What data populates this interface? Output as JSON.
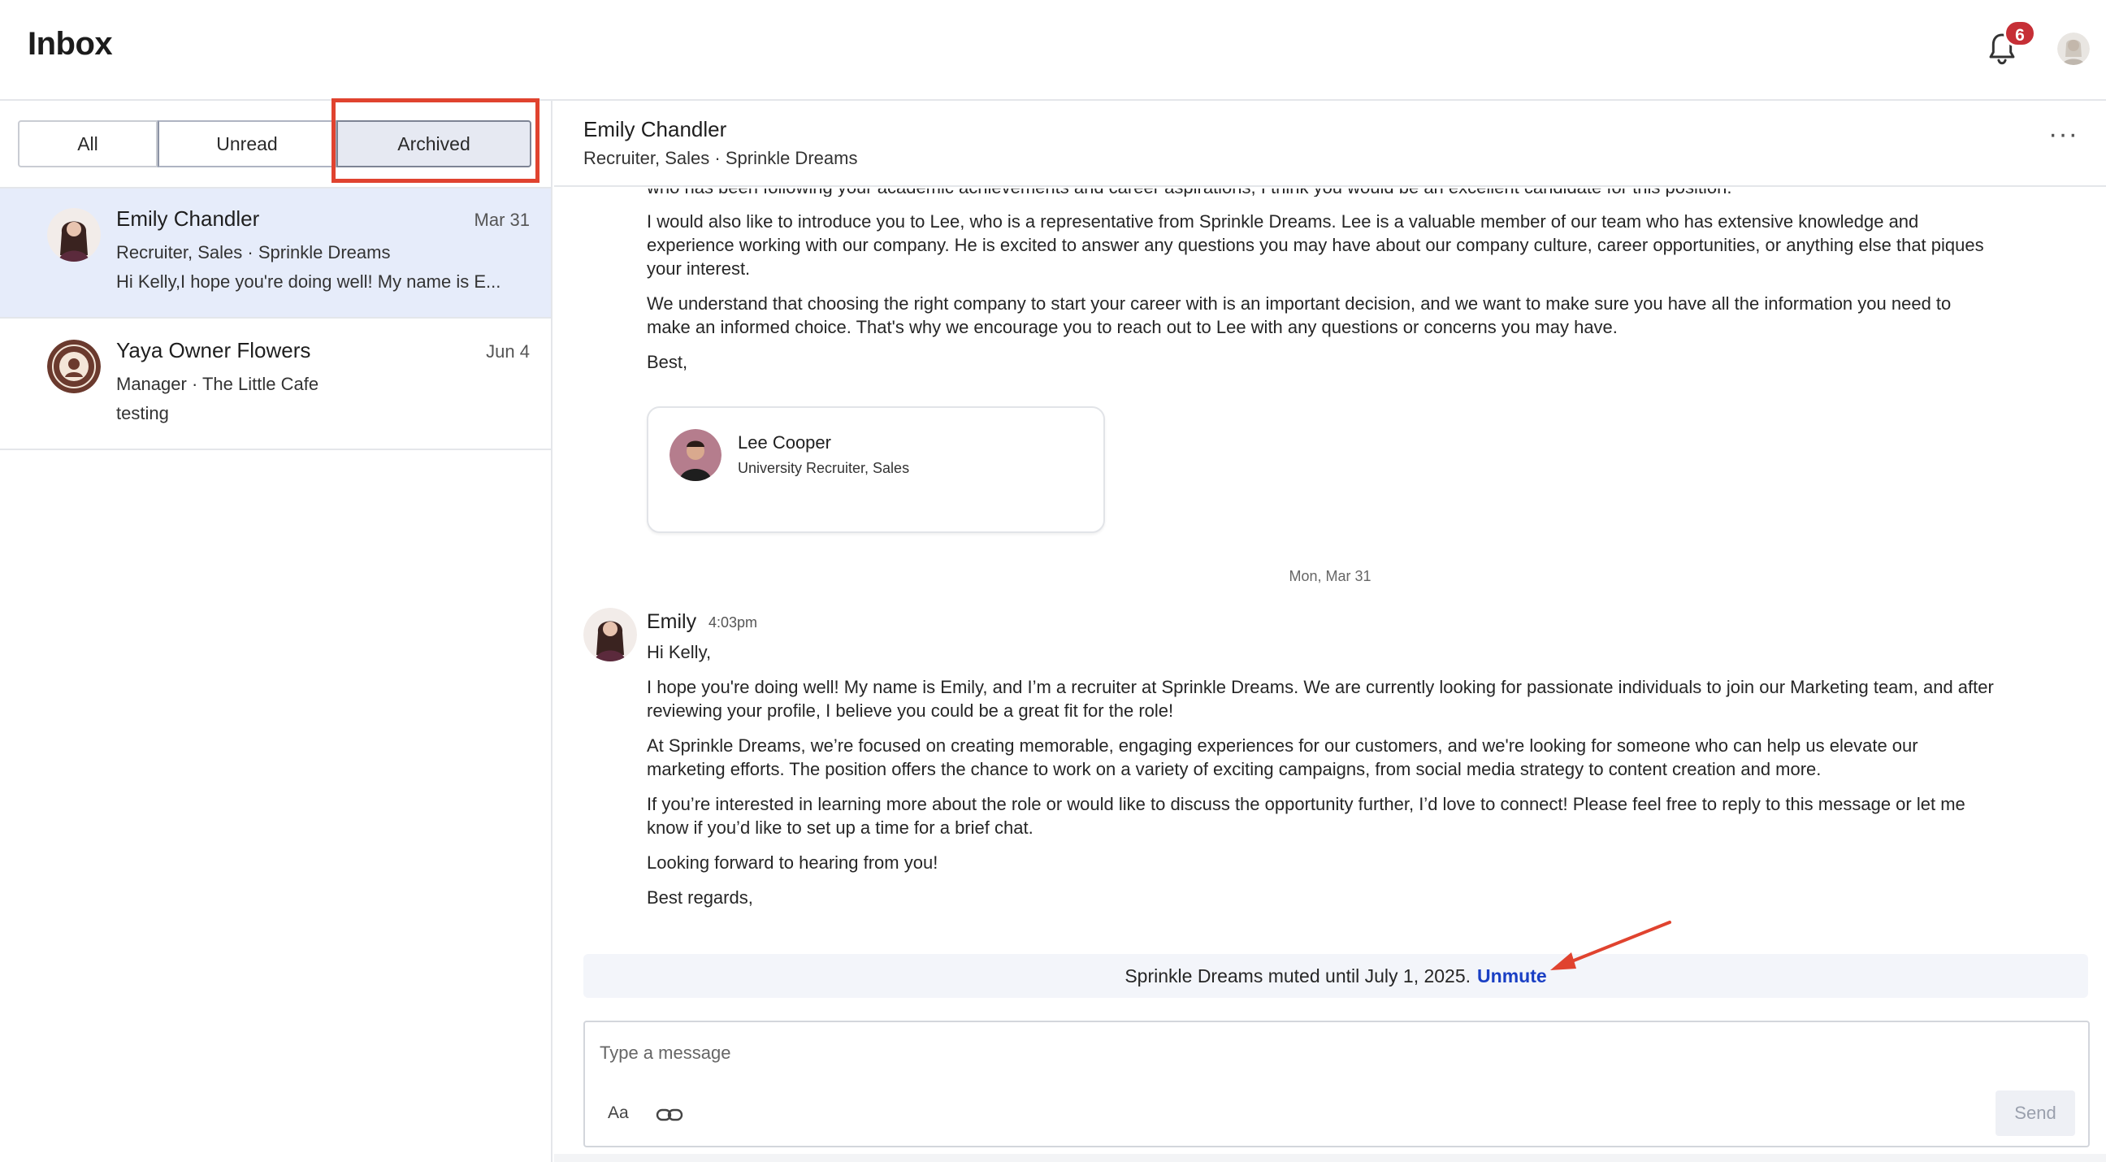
{
  "header": {
    "title": "Inbox",
    "notification_count": "6"
  },
  "filters": {
    "all": "All",
    "unread": "Unread",
    "archived": "Archived",
    "selected": "Archived"
  },
  "conversations": [
    {
      "name": "Emily Chandler",
      "date": "Mar 31",
      "subtitle": "Recruiter, Sales · Sprinkle Dreams",
      "preview": "Hi Kelly,I hope you're doing well! My name is E..."
    },
    {
      "name": "Yaya Owner Flowers",
      "date": "Jun 4",
      "subtitle": "Manager · The Little Cafe",
      "preview": "testing"
    }
  ],
  "thread": {
    "name": "Emily Chandler",
    "subtitle": "Recruiter, Sales · Sprinkle Dreams",
    "more": "···",
    "earlier": {
      "p0": "who has been following your academic achievements and career aspirations, I think you would be an excellent candidate for this position.",
      "p1": "I would also like to introduce you to Lee, who is a representative from Sprinkle Dreams. Lee is a valuable member of our team who has extensive knowledge and experience working with our company. He is excited to answer any questions you may have about our company culture, career opportunities, or anything else that piques your interest.",
      "p2": "We understand that choosing the right company to start your career with is an important decision, and we want to make sure you have all the information you need to make an informed choice. That's why we encourage you to reach out to Lee with any questions or concerns you may have.",
      "p3": "Best,"
    },
    "card": {
      "name": "Lee Cooper",
      "role": "University Recruiter, Sales"
    },
    "day_separator": "Mon, Mar 31",
    "message": {
      "sender": "Emily",
      "time": "4:03pm",
      "p0": "Hi Kelly,",
      "p1": "I hope you're doing well! My name is Emily, and I’m a recruiter at Sprinkle Dreams. We are currently looking for passionate individuals to join our Marketing team, and after reviewing your profile, I believe you could be a great fit for the role!",
      "p2": "At Sprinkle Dreams, we’re focused on creating memorable, engaging experiences for our customers, and we're looking for someone who can help us elevate our marketing efforts. The position offers the chance to work on a variety of exciting campaigns, from social media strategy to content creation and more.",
      "p3": "If you’re interested in learning more about the role or would like to discuss the opportunity further, I’d love to connect! Please feel free to reply to this message or let me know if you’d like to set up a time for a brief chat.",
      "p4": "Looking forward to hearing from you!",
      "p5": "Best regards,"
    }
  },
  "mute": {
    "text": "Sprinkle Dreams muted until July 1, 2025.",
    "action": "Unmute"
  },
  "composer": {
    "placeholder": "Type a message",
    "format_label": "Aa",
    "send_label": "Send"
  },
  "colors": {
    "accent_link": "#1a3fc4",
    "badge": "#c62f36",
    "active_row": "#e6ecfa",
    "annotation": "#e0432f"
  }
}
